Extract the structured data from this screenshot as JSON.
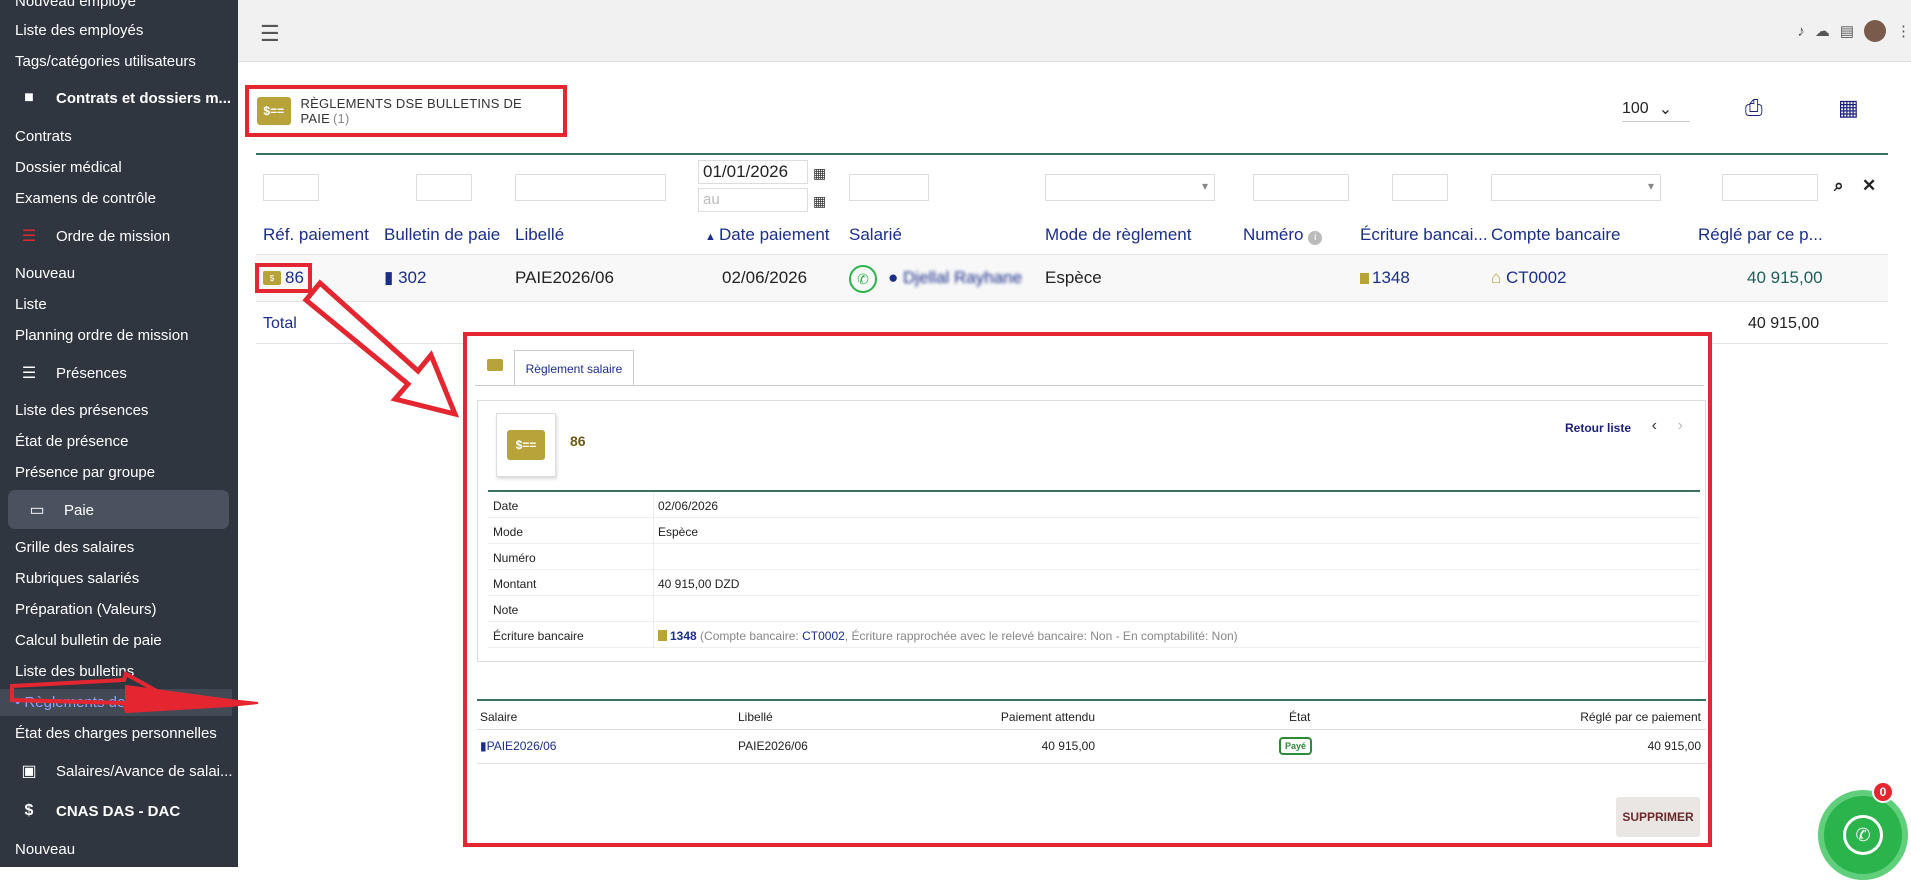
{
  "sidebar": {
    "items": [
      {
        "label": "Nouveau employé"
      },
      {
        "label": "Liste des employés"
      },
      {
        "label": "Tags/catégories utilisateurs"
      },
      {
        "label": "Contrats et dossiers m..."
      },
      {
        "label": "Contrats"
      },
      {
        "label": "Dossier médical"
      },
      {
        "label": "Examens de contrôle"
      },
      {
        "label": "Ordre de mission"
      },
      {
        "label": "Nouveau"
      },
      {
        "label": "Liste"
      },
      {
        "label": "Planning ordre de mission"
      },
      {
        "label": "Présences"
      },
      {
        "label": "Liste des présences"
      },
      {
        "label": "État de présence"
      },
      {
        "label": "Présence par groupe"
      },
      {
        "label": "Paie"
      },
      {
        "label": "Grille des salaires"
      },
      {
        "label": "Rubriques salariés"
      },
      {
        "label": "Préparation (Valeurs)"
      },
      {
        "label": "Calcul bulletin de paie"
      },
      {
        "label": "Liste des bulletins"
      },
      {
        "label": "Règlements des salaires"
      },
      {
        "label": "État des charges personnelles"
      },
      {
        "label": "Salaires/Avance de salai..."
      },
      {
        "label": "CNAS DAS - DAC"
      },
      {
        "label": "Nouveau"
      }
    ]
  },
  "header": {
    "title": "RÈGLEMENTS DSE BULLETINS DE PAIE",
    "count": "(1)",
    "page_size": "100"
  },
  "filters": {
    "date_from": "01/01/2026",
    "date_to_placeholder": "au"
  },
  "table": {
    "columns": [
      "Réf. paiement",
      "Bulletin de paie",
      "Libellé",
      "Date paiement",
      "Salarié",
      "Mode de règlement",
      "Numéro",
      "Écriture bancai...",
      "Compte bancaire",
      "Réglé par ce p..."
    ],
    "row": {
      "ref": "86",
      "bulletin": "302",
      "libelle": "PAIE2026/06",
      "date": "02/06/2026",
      "salarie": "Djellal Rayhane",
      "mode": "Espèce",
      "ecriture": "1348",
      "compte": "CT0002",
      "montant": "40 915,00"
    },
    "total_label": "Total",
    "total_value": "40 915,00"
  },
  "popup": {
    "tab_label": "Règlement salaire",
    "ref": "86",
    "back_label": "Retour liste",
    "details": {
      "date_label": "Date",
      "date_value": "02/06/2026",
      "mode_label": "Mode",
      "mode_value": "Espèce",
      "numero_label": "Numéro",
      "numero_value": "",
      "montant_label": "Montant",
      "montant_value": "40 915,00 DZD",
      "note_label": "Note",
      "note_value": "",
      "ecriture_label": "Écriture bancaire",
      "ecriture_num": "1348",
      "ecriture_pre": "(Compte bancaire: ",
      "ecriture_compte": "CT0002",
      "ecriture_post": ", Écriture rapprochée avec le relevé bancaire: Non - En comptabilité: Non)"
    },
    "sub_table": {
      "headers": [
        "Salaire",
        "Libellé",
        "Paiement attendu",
        "État",
        "Réglé par ce paiement"
      ],
      "row": {
        "salaire": "PAIE2026/06",
        "libelle": "PAIE2026/06",
        "attendu": "40 915,00",
        "etat": "Payé",
        "regle": "40 915,00"
      }
    },
    "delete_label": "SUPPRIMER"
  },
  "whatsapp": {
    "count": "0"
  },
  "colors": {
    "sidebar": "#2f3640",
    "accent_red": "#e3262f",
    "link_blue": "#1a2e8a",
    "pay_gold": "#b7a33a",
    "paid_green": "#2d8a3a"
  }
}
